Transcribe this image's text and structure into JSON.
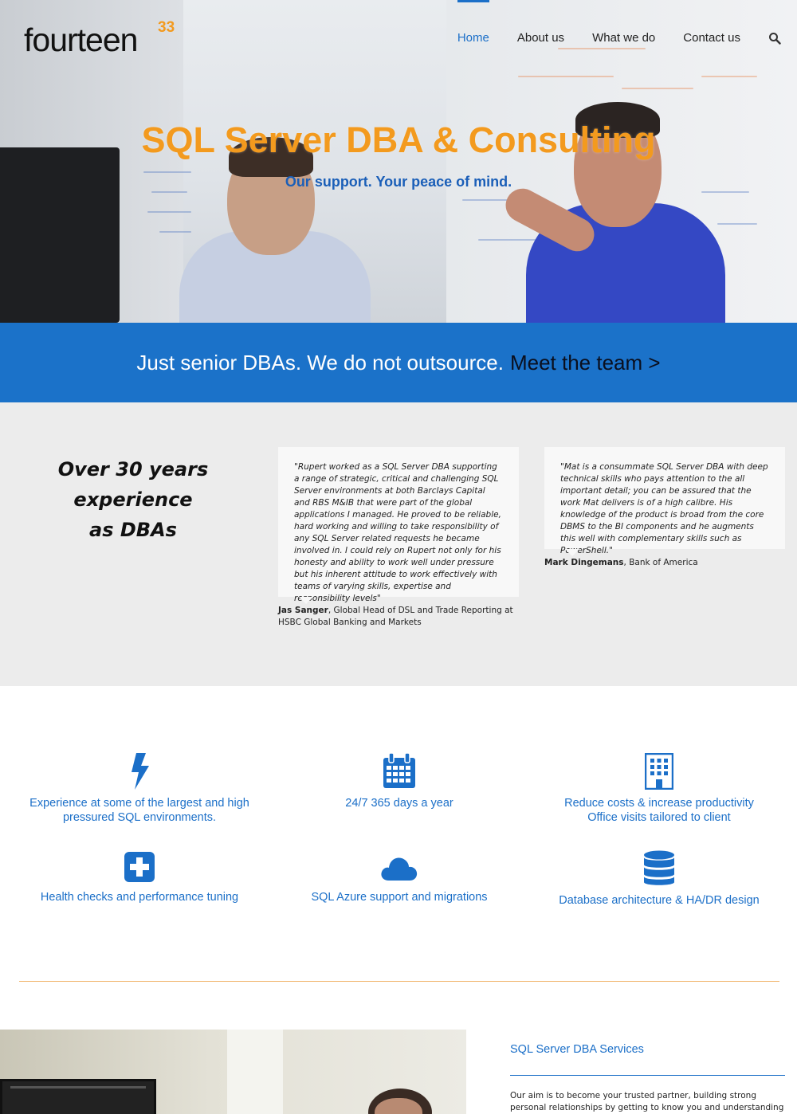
{
  "brand": {
    "logo_main": "fourteen",
    "logo_sup": "33",
    "accent": "#f39a1e",
    "primary": "#1b72c9"
  },
  "nav": {
    "items": [
      {
        "label": "Home",
        "active": true
      },
      {
        "label": "About us",
        "active": false
      },
      {
        "label": "What we do",
        "active": false
      },
      {
        "label": "Contact us",
        "active": false
      }
    ],
    "search_icon": "search-icon"
  },
  "hero": {
    "title": "SQL Server DBA & Consulting",
    "subtitle": "Our support. Your peace of mind."
  },
  "band": {
    "text": "Just senior DBAs. We do not outsource.",
    "link": "Meet the team >"
  },
  "experience": {
    "line1": "Over 30 years",
    "line2": "experience",
    "line3": "as DBAs"
  },
  "testimonials": [
    {
      "quote": "\"Rupert worked as a SQL Server DBA supporting a range of strategic, critical and challenging SQL Server environments at both Barclays Capital and RBS M&IB that were part of the global applications I managed. He proved to be reliable, hard working and willing to take responsibility of any SQL Server related requests he became involved in. I could rely on Rupert not only for his honesty and ability to work well under pressure but his inherent attitude to work effectively with teams of varying skills, expertise and responsibility levels\"",
      "author": "Jas Sanger",
      "role": ", Global Head of DSL and Trade Reporting at HSBC Global Banking and Markets"
    },
    {
      "quote": "\"Mat is a consummate SQL Server DBA with deep technical skills who pays attention to the all important detail; you can be assured that the work Mat delivers is of a high calibre. His knowledge of the product is broad from the core DBMS to the BI components and he augments this well with complementary skills such as PowerShell.\"",
      "author": "Mark Dingemans",
      "role": ", Bank of America"
    }
  ],
  "features": [
    {
      "icon": "lightning-icon",
      "line1": "Experience at some of the largest and high",
      "line2": "pressured SQL environments."
    },
    {
      "icon": "calendar-icon",
      "line1": "24/7 365 days a year",
      "line2": ""
    },
    {
      "icon": "building-icon",
      "line1": "Reduce costs & increase productivity",
      "line2": "Office visits tailored to client"
    },
    {
      "icon": "plus-square-icon",
      "line1": "Health checks and performance tuning",
      "line2": ""
    },
    {
      "icon": "cloud-icon",
      "line1": "SQL Azure support and migrations",
      "line2": ""
    },
    {
      "icon": "database-icon",
      "line1": "Database architecture & HA/DR design",
      "line2": ""
    }
  ],
  "services": {
    "title": "SQL Server DBA Services",
    "text": "Our aim is to become your trusted partner, building strong personal relationships by getting to know you and understanding your Microsoft"
  }
}
